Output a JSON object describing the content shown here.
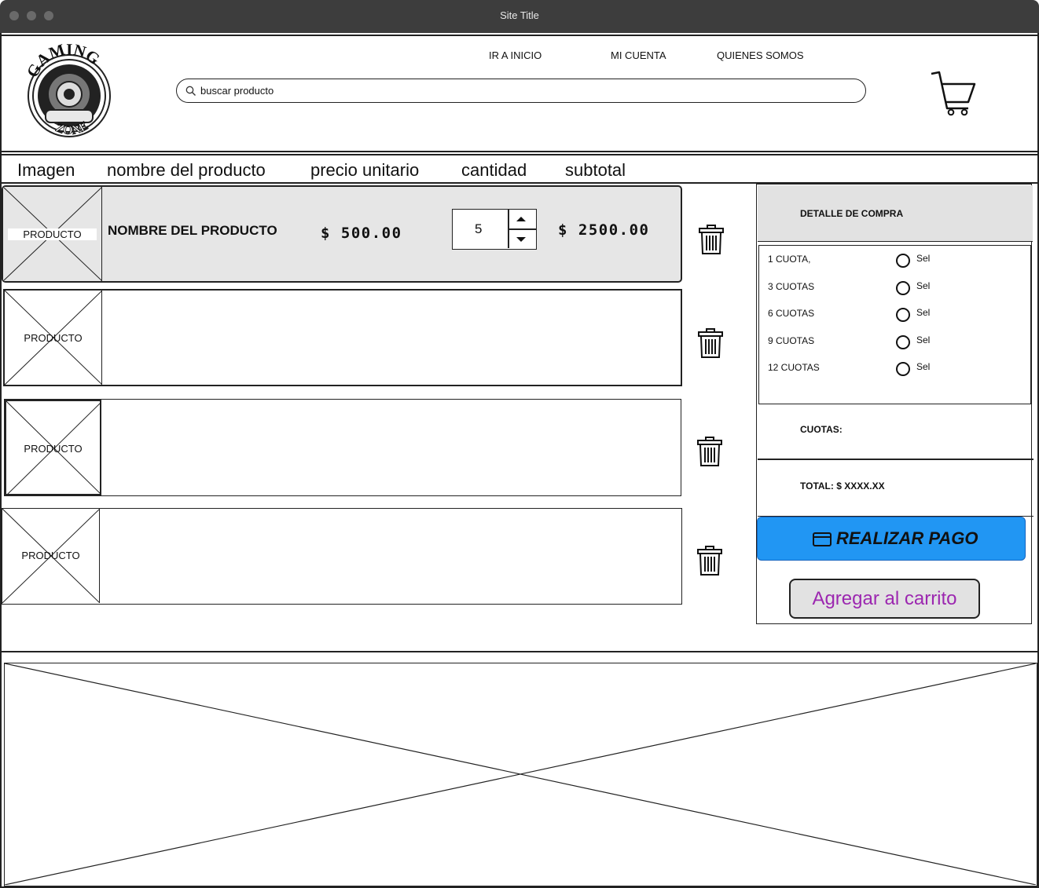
{
  "window": {
    "title": "Site Title"
  },
  "logo": {
    "text_top": "GAMING",
    "text_bottom": "ZONE"
  },
  "nav": {
    "home": "IR A INICIO",
    "account": "MI CUENTA",
    "about": "QUIENES SOMOS"
  },
  "search": {
    "value": "buscar producto"
  },
  "columns": {
    "image": "Imagen",
    "name": "nombre del producto",
    "unit_price": "precio unitario",
    "quantity": "cantidad",
    "subtotal": "subtotal"
  },
  "cart_items": [
    {
      "image_label": "PRODUCTO",
      "name": "NOMBRE DEL PRODUCTO",
      "price": "$ 500.00",
      "quantity": "5",
      "subtotal": "$ 2500.00"
    },
    {
      "image_label": "PRODUCTO"
    },
    {
      "image_label": "PRODUCTO"
    },
    {
      "image_label": "PRODUCTO"
    }
  ],
  "summary": {
    "title": "DETALLE DE COMPRA",
    "installments": [
      {
        "label": "1 CUOTA,",
        "option": "Sel"
      },
      {
        "label": "3 CUOTAS",
        "option": "Sel"
      },
      {
        "label": "6 CUOTAS",
        "option": "Sel"
      },
      {
        "label": "9 CUOTAS",
        "option": "Sel"
      },
      {
        "label": "12 CUOTAS",
        "option": "Sel"
      }
    ],
    "cuotas_label": "CUOTAS:",
    "total_label": "TOTAL: $ XXXX.XX"
  },
  "buttons": {
    "pay": "REALIZAR PAGO",
    "add_to_cart": "Agregar al carrito"
  },
  "colors": {
    "pay_button": "#2196f3",
    "add_to_cart_text": "#9c27b0",
    "highlight_row": "#e6e6e6",
    "titlebar": "#3d3d3d"
  }
}
